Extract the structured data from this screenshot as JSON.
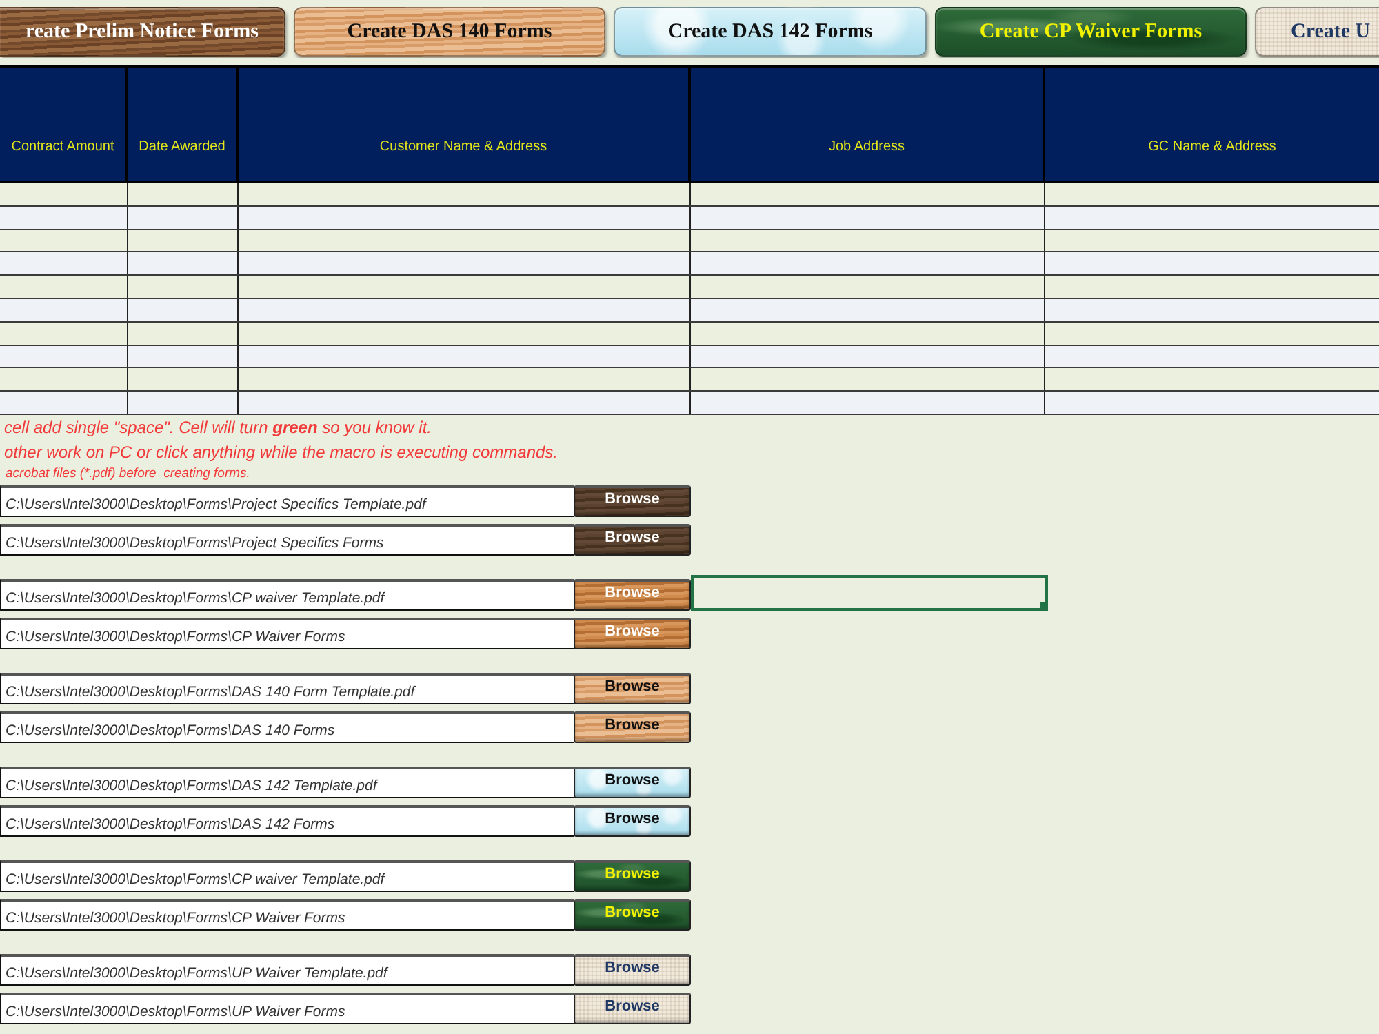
{
  "toolbar_buttons": [
    {
      "label": "reate Prelim Notice Forms",
      "kind": "dark-wood"
    },
    {
      "label": "Create DAS 140 Forms",
      "kind": "light-wood"
    },
    {
      "label": "Create DAS 142 Forms",
      "kind": "water"
    },
    {
      "label": "Create CP Waiver Forms",
      "kind": "marble"
    },
    {
      "label": "Create U",
      "kind": "linen"
    }
  ],
  "table": {
    "columns": [
      "Contract Amount",
      "Date Awarded",
      "Customer Name & Address",
      "Job Address",
      "GC Name & Address"
    ]
  },
  "notes": [
    "cell add single \"space\". Cell will turn **green** so you know it.",
    "other work on PC or click anything while the macro is executing commands.",
    "acrobat files (*.pdf) before  creating forms."
  ],
  "path_groups": [
    {
      "kind": "walnut",
      "fields": [
        {
          "value": "C:\\Users\\Intel3000\\Desktop\\Forms\\Project Specifics Template.pdf",
          "button": "Browse",
          "selected": false
        },
        {
          "value": "C:\\Users\\Intel3000\\Desktop\\Forms\\Project Specifics Forms",
          "button": "Browse",
          "selected": false
        }
      ]
    },
    {
      "kind": "oak",
      "fields": [
        {
          "value": "C:\\Users\\Intel3000\\Desktop\\Forms\\CP waiver Template.pdf",
          "button": "Browse",
          "selected": true
        },
        {
          "value": "C:\\Users\\Intel3000\\Desktop\\Forms\\CP Waiver Forms",
          "button": "Browse",
          "selected": false
        }
      ]
    },
    {
      "kind": "light-wood",
      "fields": [
        {
          "value": "C:\\Users\\Intel3000\\Desktop\\Forms\\DAS 140 Form Template.pdf",
          "button": "Browse",
          "selected": false
        },
        {
          "value": "C:\\Users\\Intel3000\\Desktop\\Forms\\DAS 140 Forms",
          "button": "Browse",
          "selected": false
        }
      ]
    },
    {
      "kind": "water",
      "fields": [
        {
          "value": "C:\\Users\\Intel3000\\Desktop\\Forms\\DAS 142 Template.pdf",
          "button": "Browse",
          "selected": false
        },
        {
          "value": "C:\\Users\\Intel3000\\Desktop\\Forms\\DAS 142 Forms",
          "button": "Browse",
          "selected": false
        }
      ]
    },
    {
      "kind": "marble",
      "fields": [
        {
          "value": "C:\\Users\\Intel3000\\Desktop\\Forms\\CP waiver Template.pdf",
          "button": "Browse",
          "selected": false
        },
        {
          "value": "C:\\Users\\Intel3000\\Desktop\\Forms\\CP Waiver Forms",
          "button": "Browse",
          "selected": false
        }
      ]
    },
    {
      "kind": "linen",
      "fields": [
        {
          "value": "C:\\Users\\Intel3000\\Desktop\\Forms\\UP Waiver Template.pdf",
          "button": "Browse",
          "selected": false
        },
        {
          "value": "C:\\Users\\Intel3000\\Desktop\\Forms\\UP Waiver Forms",
          "button": "Browse",
          "selected": false
        }
      ]
    }
  ]
}
